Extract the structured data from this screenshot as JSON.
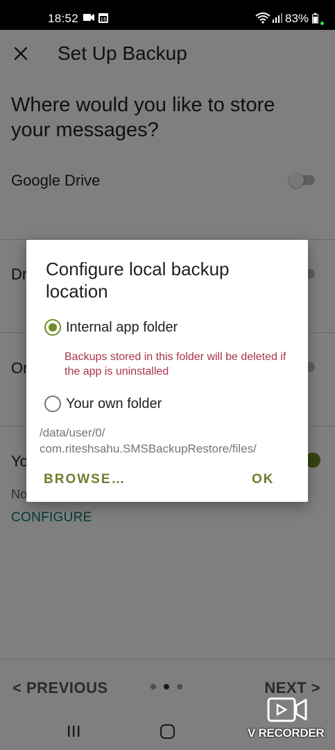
{
  "status_bar": {
    "time": "18:52",
    "battery": "83%"
  },
  "app_bar": {
    "title": "Set Up Backup"
  },
  "page": {
    "question": "Where would you like to store your messages?",
    "options": [
      {
        "label": "Google Drive",
        "enabled": false
      },
      {
        "label": "Dr",
        "enabled": false
      },
      {
        "label": "Or",
        "enabled": false
      },
      {
        "label": "Yo",
        "enabled": true
      }
    ],
    "local_sub": "No",
    "configure_label": "CONFIGURE"
  },
  "dialog": {
    "title": "Configure local backup location",
    "internal_label": "Internal app folder",
    "internal_selected": true,
    "warning": "Backups stored in this folder will be deleted if the app is uninstalled",
    "own_label": "Your own folder",
    "path": "/data/user/0/\ncom.riteshsahu.SMSBackupRestore/files/",
    "browse_label": "BROWSE…",
    "ok_label": "OK"
  },
  "bottom_nav": {
    "prev_label": "< PREVIOUS",
    "next_label": "NEXT >",
    "page_index": 2,
    "page_count": 3
  },
  "watermark": {
    "text": "V RECORDER"
  },
  "colors": {
    "accent": "#6b8e23",
    "warning": "#a8324b",
    "link": "#00796b"
  }
}
